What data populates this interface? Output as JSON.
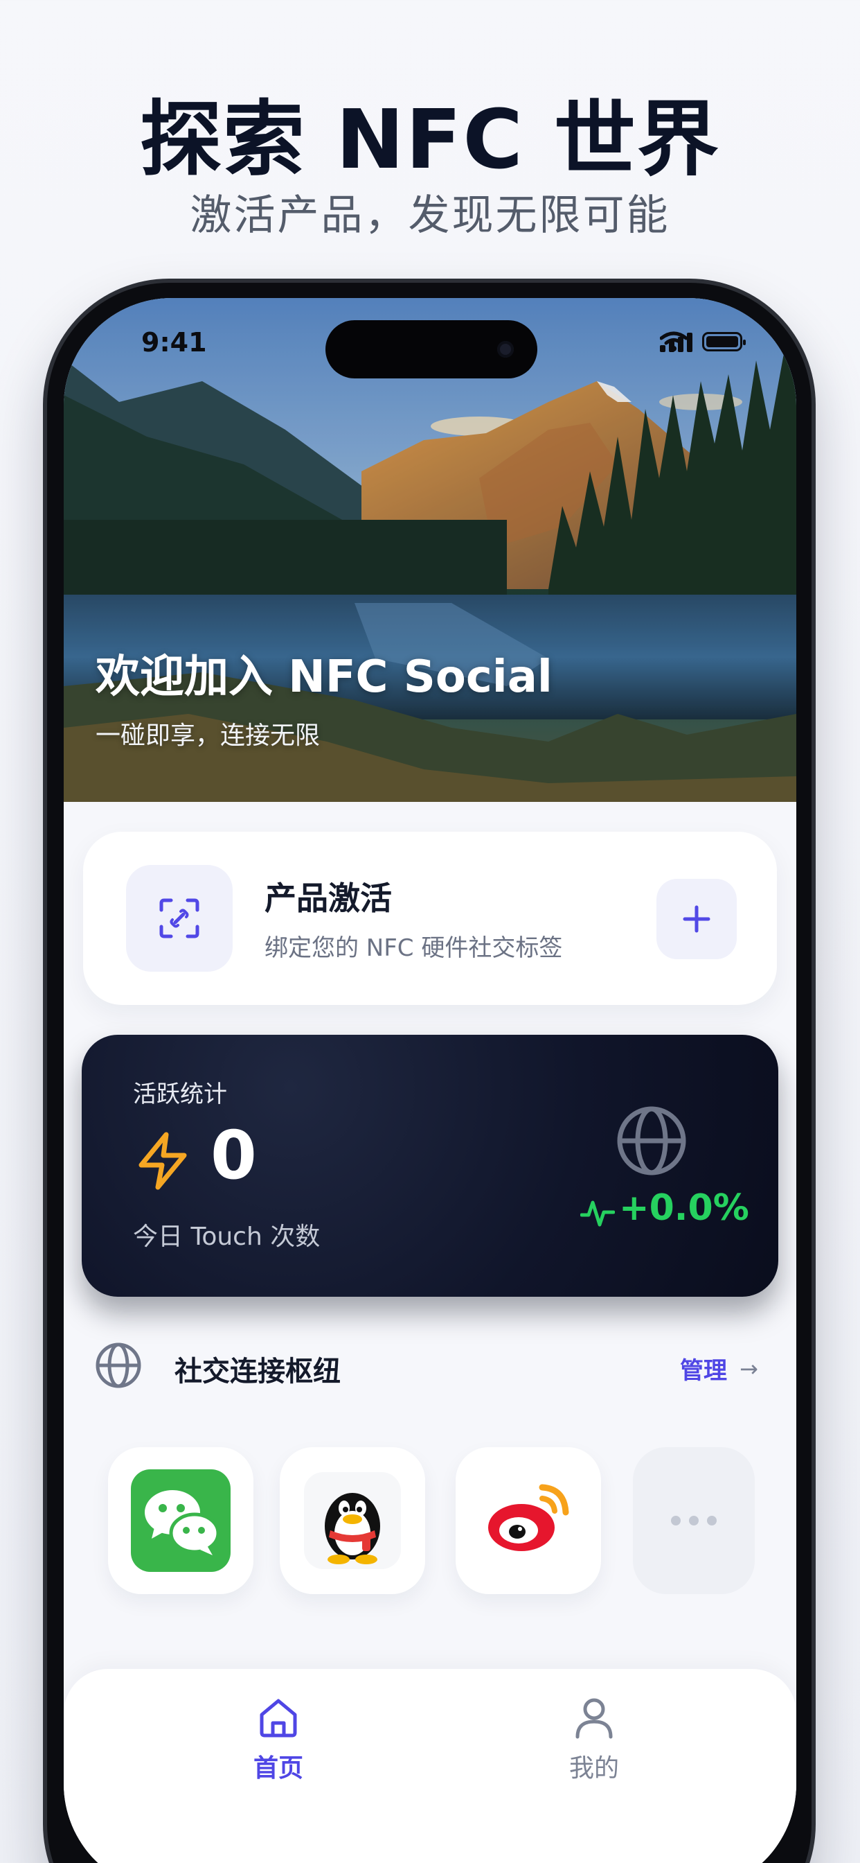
{
  "promo": {
    "title": "探索 NFC 世界",
    "subtitle": "激活产品，发现无限可能"
  },
  "status_bar": {
    "time": "9:41"
  },
  "hero": {
    "title": "欢迎加入 NFC Social",
    "subtitle": "一碰即享，连接无限"
  },
  "activation_card": {
    "title": "产品激活",
    "description": "绑定您的 NFC 硬件社交标签",
    "scan_icon": "scan-frame-icon",
    "add_icon": "plus-icon"
  },
  "stats_card": {
    "label": "活跃统计",
    "value": "0",
    "caption": "今日 Touch 次数",
    "delta": "+0.0%",
    "value_icon": "lightning-icon",
    "trend_icon": "pulse-icon",
    "badge_icon": "globe-icon"
  },
  "social_section": {
    "title": "社交连接枢纽",
    "manage_label": "管理",
    "manage_arrow": "→",
    "icon": "globe-icon",
    "apps": [
      "wechat-icon",
      "qq-icon",
      "weibo-icon",
      "more-icon"
    ]
  },
  "tab_bar": {
    "tabs": [
      {
        "label": "首页",
        "icon": "home-icon",
        "active": true
      },
      {
        "label": "我的",
        "icon": "user-icon",
        "active": false
      }
    ]
  },
  "colors": {
    "accent": "#4f46e5",
    "positive": "#26d15f",
    "stats_bg": "#10152a",
    "bolt": "#f5a623"
  }
}
